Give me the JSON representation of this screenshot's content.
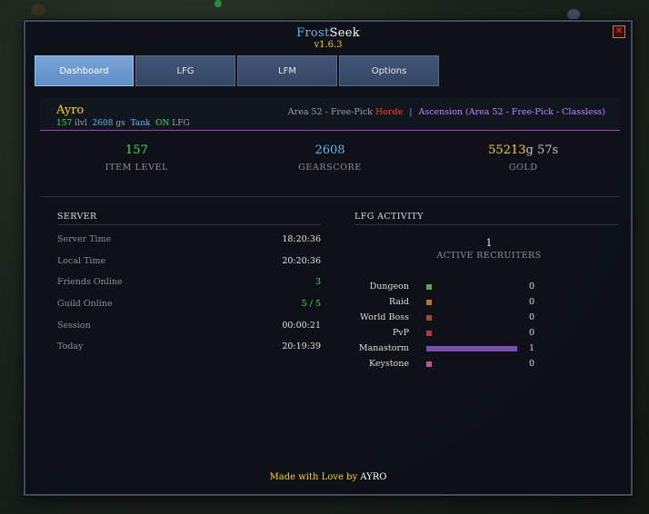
{
  "app": {
    "name_part1": "Frost",
    "name_part2": "Seek",
    "version": "v1.6.3",
    "close_glyph": "✕"
  },
  "tabs": [
    {
      "label": "Dashboard",
      "active": true
    },
    {
      "label": "LFG",
      "active": false
    },
    {
      "label": "LFM",
      "active": false
    },
    {
      "label": "Options",
      "active": false
    }
  ],
  "character": {
    "name": "Ayro",
    "ilvl_value": "157",
    "ilvl_unit": "ilvl",
    "gs_value": "2608",
    "gs_unit": "gs",
    "role": "Tank",
    "lfg_state": "ON",
    "lfg_label": "LFG",
    "realm": "Area 52 - Free-Pick",
    "faction": "Horde",
    "separator": "|",
    "guild": "Ascension (Area 52 - Free-Pick - Classless)"
  },
  "stats": {
    "item_level": {
      "value": "157",
      "label": "ITEM LEVEL"
    },
    "gearscore": {
      "value": "2608",
      "label": "GEARSCORE"
    },
    "gold": {
      "gold": "55213",
      "gold_unit": "g",
      "silver": "57",
      "silver_unit": "s",
      "label": "GOLD"
    }
  },
  "server": {
    "title": "SERVER",
    "rows": [
      {
        "label": "Server Time",
        "value": "18:20:36"
      },
      {
        "label": "Local Time",
        "value": "20:20:36"
      },
      {
        "label": "Friends Online",
        "value": "3"
      },
      {
        "label": "Guild Online",
        "value": "5 / 5"
      },
      {
        "label": "Session",
        "value": "00:00:21"
      },
      {
        "label": "Today",
        "value": "20:19:39"
      }
    ]
  },
  "lfg_activity": {
    "title": "LFG ACTIVITY",
    "active_recruiters": "1",
    "active_recruiters_label": "ACTIVE RECRUITERS",
    "categories": [
      {
        "name": "Dungeon",
        "count": "0",
        "fraction": 0,
        "color": "#5aa55a"
      },
      {
        "name": "Raid",
        "count": "0",
        "fraction": 0,
        "color": "#b87333"
      },
      {
        "name": "World Boss",
        "count": "0",
        "fraction": 0,
        "color": "#a64b38"
      },
      {
        "name": "PvP",
        "count": "0",
        "fraction": 0,
        "color": "#b43c3c"
      },
      {
        "name": "Manastorm",
        "count": "1",
        "fraction": 1,
        "color": "#7a4fb4"
      },
      {
        "name": "Keystone",
        "count": "0",
        "fraction": 0,
        "color": "#b85c82"
      }
    ]
  },
  "footer": {
    "text": "Made with Love by",
    "author": "AYRO"
  }
}
